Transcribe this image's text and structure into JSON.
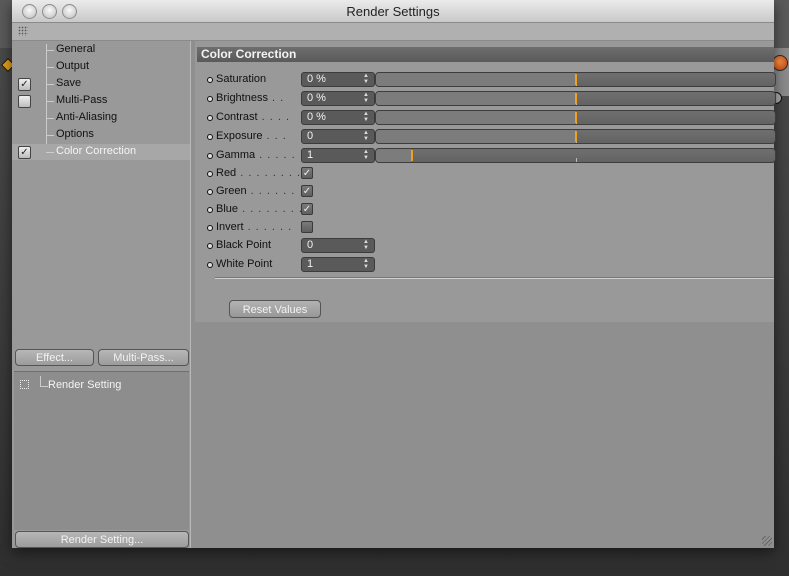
{
  "window": {
    "title": "Render Settings"
  },
  "sidebar": {
    "items": [
      {
        "label": "General",
        "has_checkbox": false,
        "checked": false,
        "selected": false
      },
      {
        "label": "Output",
        "has_checkbox": false,
        "checked": false,
        "selected": false
      },
      {
        "label": "Save",
        "has_checkbox": true,
        "checked": true,
        "selected": false
      },
      {
        "label": "Multi-Pass",
        "has_checkbox": true,
        "checked": false,
        "selected": false
      },
      {
        "label": "Anti-Aliasing",
        "has_checkbox": false,
        "checked": false,
        "selected": false
      },
      {
        "label": "Options",
        "has_checkbox": false,
        "checked": false,
        "selected": false
      },
      {
        "label": "Color Correction",
        "has_checkbox": true,
        "checked": true,
        "selected": true
      }
    ],
    "effect_button": "Effect...",
    "multipass_button": "Multi-Pass...",
    "render_setting_item": "Render Setting",
    "render_setting_button": "Render Setting..."
  },
  "section": {
    "title": "Color Correction",
    "sliders": [
      {
        "label": "Saturation",
        "leader": " ",
        "value": "0 %",
        "level": 0.5
      },
      {
        "label": "Brightness",
        "leader": " . .",
        "value": "0 %",
        "level": 0.5
      },
      {
        "label": "Contrast",
        "leader": " . . . .",
        "value": "0 %",
        "level": 0.5
      },
      {
        "label": "Exposure",
        "leader": " . . .",
        "value": "0",
        "level": 0.5
      },
      {
        "label": "Gamma",
        "leader": " . . . . .",
        "value": "1",
        "level": 0.09
      }
    ],
    "checkboxes": [
      {
        "label": "Red",
        "leader": " . . . . . . . .",
        "checked": true
      },
      {
        "label": "Green",
        "leader": " . . . . . .",
        "checked": true
      },
      {
        "label": "Blue",
        "leader": " . . . . . . . .",
        "checked": true
      },
      {
        "label": "Invert",
        "leader": " . . . . . .",
        "checked": false
      }
    ],
    "fields": [
      {
        "label": "Black Point",
        "value": "0"
      },
      {
        "label": "White Point",
        "value": "1"
      }
    ],
    "reset_button": "Reset Values"
  },
  "colors": {
    "accent": "#f0a020",
    "selected_text": "#f4f4f4"
  }
}
